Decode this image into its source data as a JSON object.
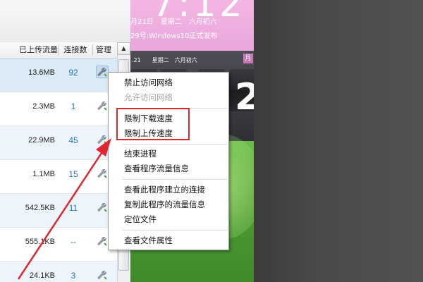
{
  "table": {
    "headers": {
      "uploaded": "已上传流量",
      "connections": "连接数",
      "manage": "管理"
    },
    "rows": [
      {
        "uploaded": "13.6MB",
        "connections": "92"
      },
      {
        "uploaded": "2.3MB",
        "connections": "1"
      },
      {
        "uploaded": "22.9MB",
        "connections": "45"
      },
      {
        "uploaded": "1.1MB",
        "connections": "15"
      },
      {
        "uploaded": "542.5KB",
        "connections": "11"
      },
      {
        "uploaded": "555.1KB",
        "connections": "--"
      },
      {
        "uploaded": "24.1KB",
        "connections": "3"
      }
    ]
  },
  "scrollbar": {
    "up_arrow": "▲"
  },
  "desktop": {
    "big_time": "7:12",
    "big_date": "月21日　星期二　六月初六",
    "news": "29号:Windows10正式发布",
    "small_date": ".21　　星期二　六月初六",
    "flip_digit": "2",
    "corner_tag": "月"
  },
  "context_menu": {
    "items": [
      {
        "label": "禁止访问网络",
        "enabled": true
      },
      {
        "label": "允许访问网络",
        "enabled": false
      },
      {
        "label": "限制下载速度",
        "enabled": true
      },
      {
        "label": "限制上传速度",
        "enabled": true
      },
      {
        "label": "结束进程",
        "enabled": true
      },
      {
        "label": "查看程序流量信息",
        "enabled": true
      },
      {
        "label": "查看此程序建立的连接",
        "enabled": true
      },
      {
        "label": "复制此程序的流量信息",
        "enabled": true
      },
      {
        "label": "定位文件",
        "enabled": true
      },
      {
        "label": "查看文件属性",
        "enabled": true
      }
    ]
  },
  "annotation": {
    "highlight_color": "#e0262e",
    "arrow_color": "#e0262e"
  },
  "colors": {
    "connection_count": "#2a73b8",
    "selected_row": "#dbeaf7"
  }
}
